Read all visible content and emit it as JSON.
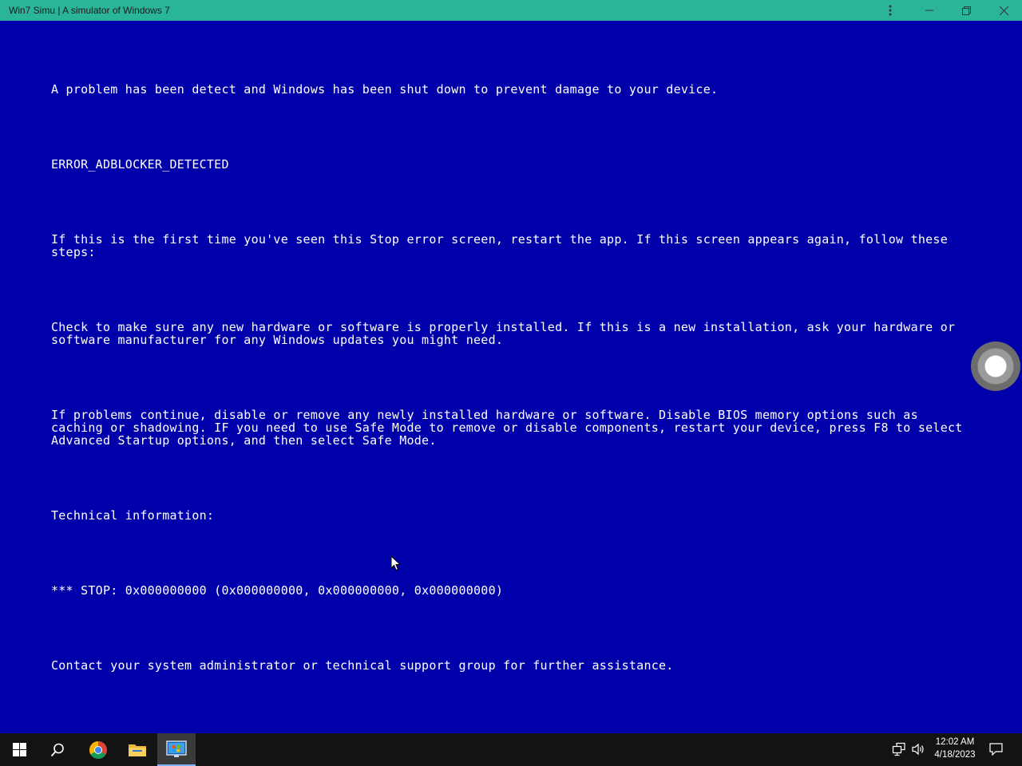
{
  "window": {
    "title": "Win7 Simu | A simulator of Windows 7"
  },
  "bsod": {
    "line1": "A problem has been detect and Windows has been shut down to prevent damage to your device.",
    "line2": "ERROR_ADBLOCKER_DETECTED",
    "line3": "If this is the first time you've seen this Stop error screen, restart the app. If this screen appears again, follow these steps:",
    "line4": "Check to make sure any new hardware or software is properly installed. If this is a new installation, ask your hardware or software manufacturer for any Windows updates you might need.",
    "line5": "If problems continue, disable or remove any newly installed hardware or software. Disable BIOS memory options such as caching or shadowing. IF you need to use Safe Mode to remove or disable components, restart your device, press F8 to select Advanced Startup options, and then select Safe Mode.",
    "line6": "Technical information:",
    "line7": "*** STOP: 0x000000000 (0x000000000, 0x000000000, 0x000000000)",
    "line8": "Contact your system administrator or technical support group for further assistance."
  },
  "taskbar": {
    "icons": [
      "windows-start-icon",
      "search-icon",
      "chrome-icon",
      "file-explorer-icon",
      "win7-simu-app-icon"
    ],
    "clock_time": "12:02 AM",
    "clock_date": "4/18/2023"
  },
  "colors": {
    "bsod_background": "#0000aa",
    "titlebar": "#2ab59a",
    "taskbar": "#131313"
  }
}
